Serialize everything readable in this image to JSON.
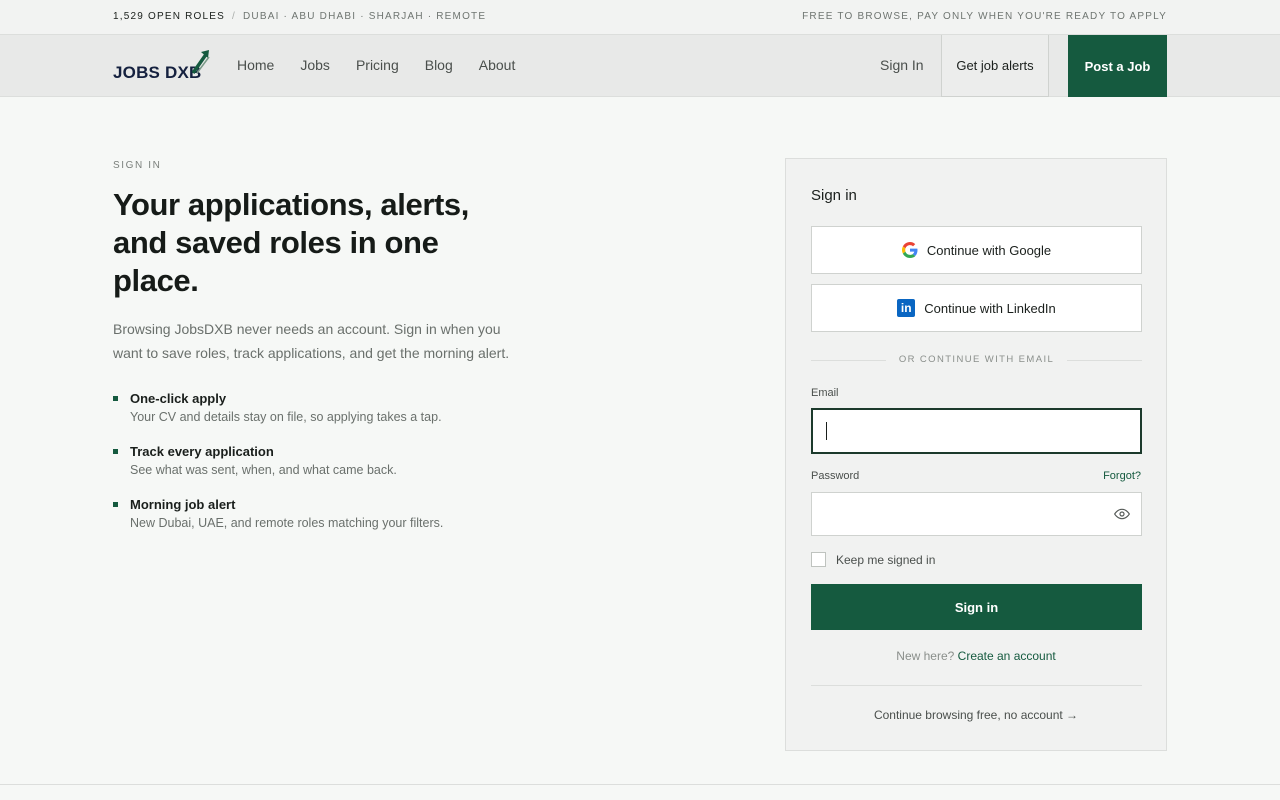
{
  "topbar": {
    "open_roles": "1,529 open roles",
    "separator": "/",
    "locations": "Dubai · Abu Dhabi · Sharjah · Remote",
    "tagline": "Free to browse, pay only when you're ready to apply"
  },
  "header": {
    "logo_text_a": "JOBS D",
    "logo_text_b": "XB",
    "nav": [
      {
        "label": "Home"
      },
      {
        "label": "Jobs"
      },
      {
        "label": "Pricing"
      },
      {
        "label": "Blog"
      },
      {
        "label": "About"
      }
    ],
    "sign_in": "Sign In",
    "alerts_button": "Get job alerts",
    "post_button": "Post a Job",
    "brand_color": "#155a3f"
  },
  "main": {
    "eyebrow": "SIGN IN",
    "headline": "Your applications, alerts, and saved roles in one place.",
    "intro": "Browsing JobsDXB never needs an account. Sign in when you want to save roles, track applications, and get the morning alert.",
    "features": [
      {
        "title": "One-click apply",
        "desc": "Your CV and details stay on file, so applying takes a tap."
      },
      {
        "title": "Track every application",
        "desc": "See what was sent, when, and what came back."
      },
      {
        "title": "Morning job alert",
        "desc": "New Dubai, UAE, and remote roles matching your filters."
      }
    ]
  },
  "card": {
    "title": "Sign in",
    "google_button": "Continue with Google",
    "linkedin_button": "Continue with LinkedIn",
    "divider": "OR CONTINUE WITH EMAIL",
    "email_label": "Email",
    "email_value": "",
    "password_label": "Password",
    "forgot": "Forgot?",
    "keep_signed_in": "Keep me signed in",
    "keep_signed_in_checked": false,
    "submit": "Sign in",
    "new_here": "New here?",
    "create_account": "Create an account",
    "browse_free": "Continue browsing free, no account →"
  }
}
